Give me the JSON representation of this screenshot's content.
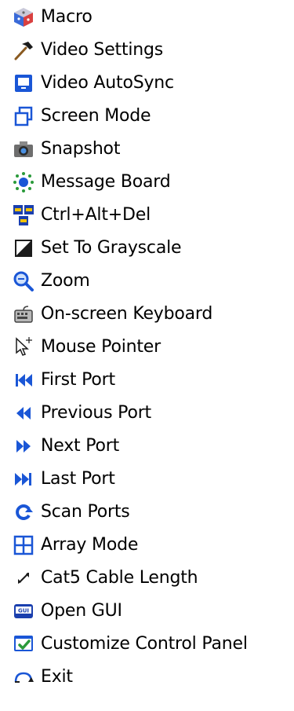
{
  "menu": {
    "items": [
      {
        "label": "Macro",
        "icon": "macro-icon"
      },
      {
        "label": "Video Settings",
        "icon": "hammer-icon"
      },
      {
        "label": "Video AutoSync",
        "icon": "autosync-icon"
      },
      {
        "label": "Screen Mode",
        "icon": "screen-mode-icon"
      },
      {
        "label": "Snapshot",
        "icon": "camera-icon"
      },
      {
        "label": "Message Board",
        "icon": "message-board-icon"
      },
      {
        "label": "Ctrl+Alt+Del",
        "icon": "ctrl-alt-del-icon"
      },
      {
        "label": "Set To Grayscale",
        "icon": "grayscale-icon"
      },
      {
        "label": "Zoom",
        "icon": "zoom-icon"
      },
      {
        "label": "On-screen Keyboard",
        "icon": "keyboard-icon"
      },
      {
        "label": "Mouse Pointer",
        "icon": "mouse-pointer-icon"
      },
      {
        "label": "First Port",
        "icon": "first-port-icon"
      },
      {
        "label": "Previous Port",
        "icon": "previous-port-icon"
      },
      {
        "label": "Next Port",
        "icon": "next-port-icon"
      },
      {
        "label": "Last Port",
        "icon": "last-port-icon"
      },
      {
        "label": "Scan Ports",
        "icon": "scan-ports-icon"
      },
      {
        "label": "Array Mode",
        "icon": "array-mode-icon"
      },
      {
        "label": "Cat5 Cable Length",
        "icon": "cable-length-icon"
      },
      {
        "label": "Open GUI",
        "icon": "gui-icon"
      },
      {
        "label": "Customize Control Panel",
        "icon": "customize-panel-icon"
      },
      {
        "label": "Exit",
        "icon": "exit-icon"
      }
    ]
  },
  "colors": {
    "icon_blue": "#1a56d6",
    "icon_dark": "#1b1b1b",
    "icon_green": "#2a9a3a"
  }
}
